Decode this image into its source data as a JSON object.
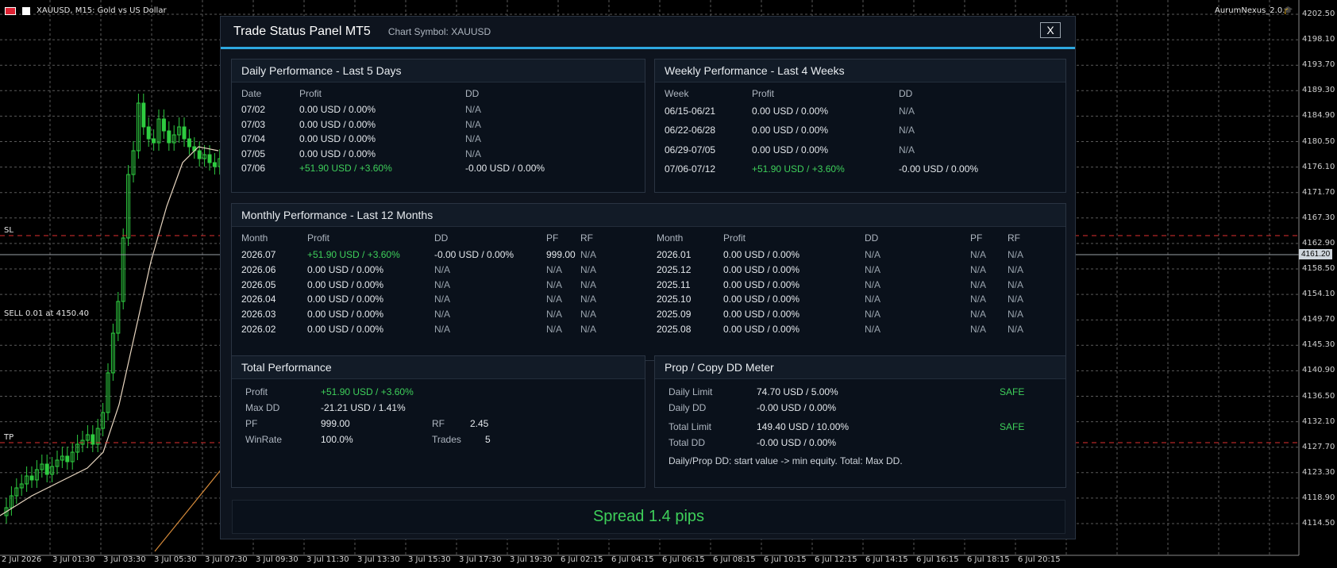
{
  "chart": {
    "title": "XAUUSD, M15:  Gold vs US Dollar",
    "ea_name": "AurumNexus_2.0.8",
    "current_price": "4161.20",
    "price_levels": [
      "4202.50",
      "4198.10",
      "4193.70",
      "4189.30",
      "4184.90",
      "4180.50",
      "4176.10",
      "4171.70",
      "4167.30",
      "4162.90",
      "4158.50",
      "4154.10",
      "4149.70",
      "4145.30",
      "4140.90",
      "4136.50",
      "4132.10",
      "4127.70",
      "4123.30",
      "4118.90",
      "4114.50"
    ],
    "time_labels": [
      "2 Jul 2026",
      "3 Jul 01:30",
      "3 Jul 03:30",
      "3 Jul 05:30",
      "3 Jul 07:30",
      "3 Jul 09:30",
      "3 Jul 11:30",
      "3 Jul 13:30",
      "3 Jul 15:30",
      "3 Jul 17:30",
      "3 Jul 19:30",
      "6 Jul 02:15",
      "6 Jul 04:15",
      "6 Jul 06:15",
      "6 Jul 08:15",
      "6 Jul 10:15",
      "6 Jul 12:15",
      "6 Jul 14:15",
      "6 Jul 16:15",
      "6 Jul 18:15",
      "6 Jul 20:15"
    ],
    "sl_label": "SL",
    "tp_label": "TP",
    "order_label": "SELL 0.01 at 4150.40",
    "colors": {
      "candle": "#2ecc40",
      "grid": "#5a5a5a",
      "sl_tp": "#e03030",
      "ma": "#e8d6c0"
    }
  },
  "panel": {
    "title": "Trade Status Panel MT5",
    "symbol_label": "Chart Symbol: XAUUSD",
    "close_label": "X",
    "daily": {
      "title": "Daily Performance - Last 5 Days",
      "headers": [
        "Date",
        "Profit",
        "DD"
      ],
      "rows": [
        [
          "07/02",
          "0.00 USD / 0.00%",
          "N/A"
        ],
        [
          "07/03",
          "0.00 USD / 0.00%",
          "N/A"
        ],
        [
          "07/04",
          "0.00 USD / 0.00%",
          "N/A"
        ],
        [
          "07/05",
          "0.00 USD / 0.00%",
          "N/A"
        ],
        [
          "07/06",
          "+51.90 USD / +3.60%",
          "-0.00 USD / 0.00%"
        ]
      ]
    },
    "weekly": {
      "title": "Weekly Performance - Last 4 Weeks",
      "headers": [
        "Week",
        "Profit",
        "DD"
      ],
      "rows": [
        [
          "06/15-06/21",
          "0.00 USD / 0.00%",
          "N/A"
        ],
        [
          "06/22-06/28",
          "0.00 USD / 0.00%",
          "N/A"
        ],
        [
          "06/29-07/05",
          "0.00 USD / 0.00%",
          "N/A"
        ],
        [
          "07/06-07/12",
          "+51.90 USD / +3.60%",
          "-0.00 USD / 0.00%"
        ]
      ]
    },
    "monthly": {
      "title": "Monthly Performance - Last 12 Months",
      "headers": [
        "Month",
        "Profit",
        "DD",
        "PF",
        "RF"
      ],
      "left": [
        [
          "2026.07",
          "+51.90 USD / +3.60%",
          "-0.00 USD / 0.00%",
          "999.00",
          "N/A"
        ],
        [
          "2026.06",
          "0.00 USD / 0.00%",
          "N/A",
          "N/A",
          "N/A"
        ],
        [
          "2026.05",
          "0.00 USD / 0.00%",
          "N/A",
          "N/A",
          "N/A"
        ],
        [
          "2026.04",
          "0.00 USD / 0.00%",
          "N/A",
          "N/A",
          "N/A"
        ],
        [
          "2026.03",
          "0.00 USD / 0.00%",
          "N/A",
          "N/A",
          "N/A"
        ],
        [
          "2026.02",
          "0.00 USD / 0.00%",
          "N/A",
          "N/A",
          "N/A"
        ]
      ],
      "right": [
        [
          "2026.01",
          "0.00 USD / 0.00%",
          "N/A",
          "N/A",
          "N/A"
        ],
        [
          "2025.12",
          "0.00 USD / 0.00%",
          "N/A",
          "N/A",
          "N/A"
        ],
        [
          "2025.11",
          "0.00 USD / 0.00%",
          "N/A",
          "N/A",
          "N/A"
        ],
        [
          "2025.10",
          "0.00 USD / 0.00%",
          "N/A",
          "N/A",
          "N/A"
        ],
        [
          "2025.09",
          "0.00 USD / 0.00%",
          "N/A",
          "N/A",
          "N/A"
        ],
        [
          "2025.08",
          "0.00 USD / 0.00%",
          "N/A",
          "N/A",
          "N/A"
        ]
      ]
    },
    "total": {
      "title": "Total Performance",
      "profit_label": "Profit",
      "profit_value": "+51.90 USD / +3.60%",
      "maxdd_label": "Max DD",
      "maxdd_value": "-21.21 USD / 1.41%",
      "pf_label": "PF",
      "pf_value": "999.00",
      "rf_label": "RF",
      "rf_value": "2.45",
      "winrate_label": "WinRate",
      "winrate_value": "100.0%",
      "trades_label": "Trades",
      "trades_value": "5"
    },
    "prop": {
      "title": "Prop / Copy DD Meter",
      "daily_limit_label": "Daily Limit",
      "daily_limit_value": "74.70 USD / 5.00%",
      "daily_status": "SAFE",
      "daily_dd_label": "Daily DD",
      "daily_dd_value": "-0.00 USD / 0.00%",
      "total_limit_label": "Total Limit",
      "total_limit_value": "149.40 USD / 10.00%",
      "total_status": "SAFE",
      "total_dd_label": "Total DD",
      "total_dd_value": "-0.00 USD / 0.00%",
      "note": "Daily/Prop DD: start value -> min equity. Total: Max DD."
    },
    "spread": "Spread  1.4 pips"
  }
}
